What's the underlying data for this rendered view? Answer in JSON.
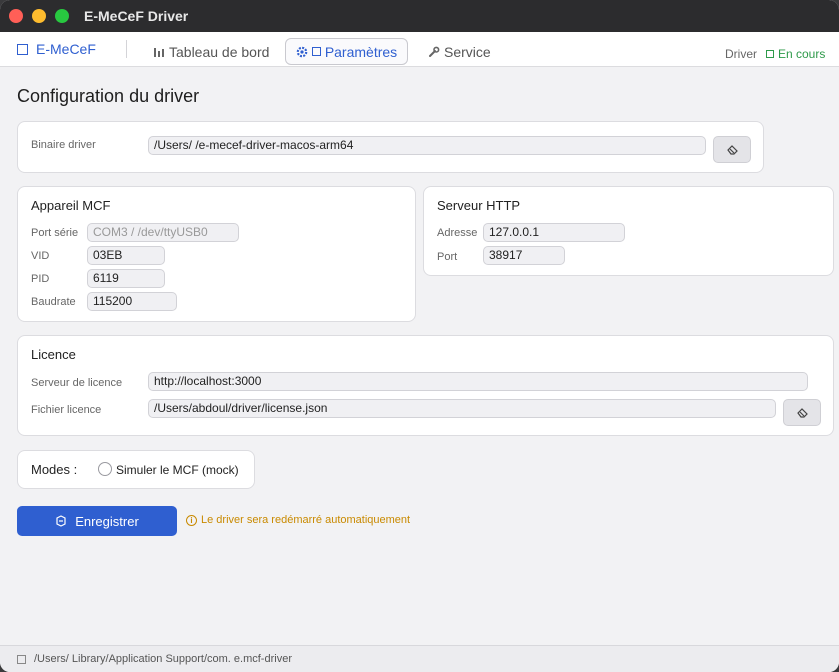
{
  "window": {
    "title": "E-MeCeF Driver"
  },
  "nav": {
    "brand": "E-MeCeF",
    "tabs": [
      {
        "label": "Tableau de bord",
        "icon": "bar-chart-icon"
      },
      {
        "label": "Paramètres",
        "icon": "gear-icon",
        "active": true
      },
      {
        "label": "Service",
        "icon": "wrench-icon"
      }
    ],
    "status_label": "Driver",
    "status_value": "En cours"
  },
  "page": {
    "title": "Configuration du driver"
  },
  "binary": {
    "label": "Binaire driver",
    "value": "/Users/                              /e-mecef-driver-macos-arm64"
  },
  "mcf": {
    "title": "Appareil MCF",
    "port_label": "Port série",
    "port_placeholder": "COM3 / /dev/ttyUSB0",
    "vid_label": "VID",
    "vid_value": "03EB",
    "pid_label": "PID",
    "pid_value": "6119",
    "baud_label": "Baudrate",
    "baud_value": "115200"
  },
  "http": {
    "title": "Serveur HTTP",
    "address_label": "Adresse",
    "address_value": "127.0.0.1",
    "port_label": "Port",
    "port_value": "38917"
  },
  "license": {
    "title": "Licence",
    "server_label": "Serveur de licence",
    "server_value": "http://localhost:3000",
    "file_label": "Fichier licence",
    "file_value": "/Users/abdoul/driver/license.json"
  },
  "modes": {
    "label": "Modes :",
    "mock_label": "Simuler le MCF (mock)",
    "mock_checked": false
  },
  "actions": {
    "save_label": "Enregistrer",
    "notice": "Le driver sera redémarré automatiquement"
  },
  "statusbar": {
    "path": "/Users/              Library/Application Support/com.               e.mcf-driver"
  },
  "colors": {
    "accent": "#2f5fd0",
    "status_ok": "#2e9a4a",
    "warning": "#c98a00"
  }
}
